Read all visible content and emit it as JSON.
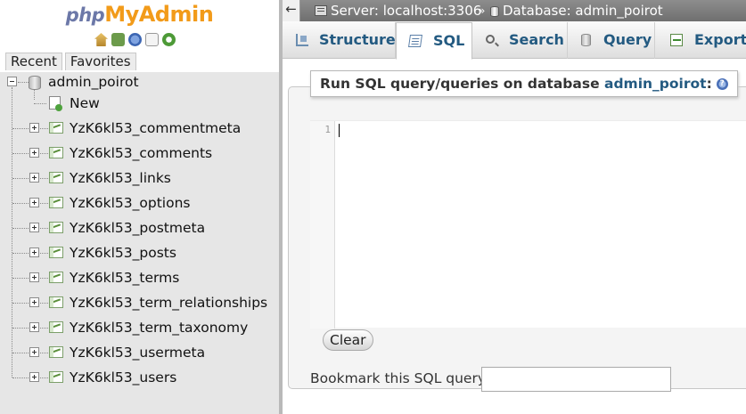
{
  "navigation": {
    "logo": {
      "php": "php",
      "my": "My",
      "admin": "Admin"
    },
    "icons": [
      "home-icon",
      "exit-icon",
      "help-icon",
      "docs-icon",
      "reload-icon"
    ],
    "tabs": {
      "recent": "Recent",
      "favorites": "Favorites"
    },
    "tree": {
      "database": "admin_poirot",
      "new_label": "New",
      "tables": [
        "YzK6kl53_commentmeta",
        "YzK6kl53_comments",
        "YzK6kl53_links",
        "YzK6kl53_options",
        "YzK6kl53_postmeta",
        "YzK6kl53_posts",
        "YzK6kl53_terms",
        "YzK6kl53_term_relationships",
        "YzK6kl53_term_taxonomy",
        "YzK6kl53_usermeta",
        "YzK6kl53_users"
      ]
    }
  },
  "breadcrumb": {
    "back": "←",
    "server": "Server: localhost:3306",
    "separator": "»",
    "database": "Database: admin_poirot"
  },
  "tabs": [
    {
      "label": "Structure",
      "icon": "structure-icon"
    },
    {
      "label": "SQL",
      "icon": "sql-icon",
      "active": true
    },
    {
      "label": "Search",
      "icon": "search-icon"
    },
    {
      "label": "Query",
      "icon": "query-icon"
    },
    {
      "label": "Export",
      "icon": "export-icon"
    }
  ],
  "sql_panel": {
    "legend_prefix": "Run SQL query/queries on database ",
    "legend_db": "admin_poirot",
    "legend_suffix": ":",
    "line_number": "1",
    "editor_value": "",
    "clear_label": "Clear",
    "bookmark_label": "Bookmark this SQL query:",
    "bookmark_value": ""
  }
}
